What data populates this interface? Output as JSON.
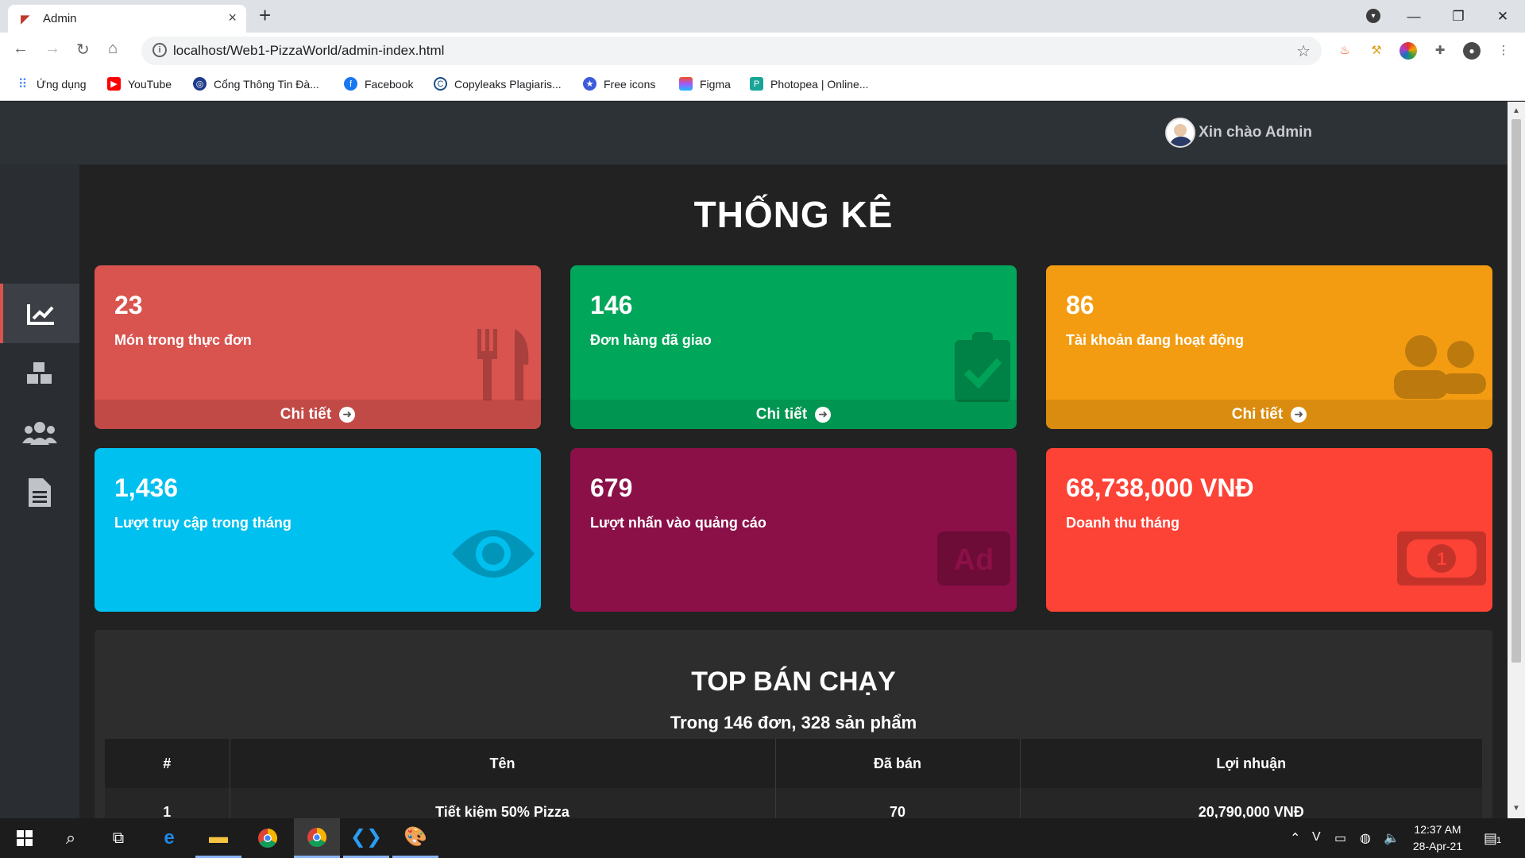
{
  "browser": {
    "tab_title": "Admin",
    "url": "localhost/Web1-PizzaWorld/admin-index.html",
    "bookmarks": [
      {
        "label": "Ứng dụng",
        "icon": "apps-grid-icon",
        "color": "#4285f4"
      },
      {
        "label": "YouTube",
        "icon": "youtube-icon",
        "color": "#ff0000"
      },
      {
        "label": "Cổng Thông Tin Đà...",
        "icon": "portal-icon",
        "color": "#1e3a8a"
      },
      {
        "label": "Facebook",
        "icon": "facebook-icon",
        "color": "#1877f2"
      },
      {
        "label": "Copyleaks Plagiaris...",
        "icon": "copyleaks-icon",
        "color": "#1b4f8a"
      },
      {
        "label": "Free icons",
        "icon": "free-icons-icon",
        "color": "#3b5bdb"
      },
      {
        "label": "Figma",
        "icon": "figma-icon",
        "color": "#f24e1e"
      },
      {
        "label": "Photopea | Online...",
        "icon": "photopea-icon",
        "color": "#18a497"
      }
    ]
  },
  "header": {
    "greeting": "Xin chào Admin"
  },
  "sidebar": {
    "items": [
      {
        "icon": "chart-line-icon",
        "active": true
      },
      {
        "icon": "cubes-icon",
        "active": false
      },
      {
        "icon": "users-icon",
        "active": false
      },
      {
        "icon": "file-alt-icon",
        "active": false
      }
    ]
  },
  "main": {
    "title": "THỐNG KÊ",
    "cards": [
      {
        "value": "23",
        "label": "Món trong thực đơn",
        "footer": "Chi tiết",
        "color": "#d9534f",
        "icon": "utensils-icon"
      },
      {
        "value": "146",
        "label": "Đơn hàng đã giao",
        "footer": "Chi tiết",
        "color": "#00a65a",
        "icon": "clipboard-check-icon"
      },
      {
        "value": "86",
        "label": "Tài khoản đang hoạt động",
        "footer": "Chi tiết",
        "color": "#f39c12",
        "icon": "users-icon"
      },
      {
        "value": "1,436",
        "label": "Lượt truy cập trong tháng",
        "color": "#00c0ef",
        "icon": "eye-icon"
      },
      {
        "value": "679",
        "label": "Lượt nhấn vào quảng cáo",
        "color": "#8b1048",
        "icon": "ad-icon"
      },
      {
        "value": "68,738,000 VNĐ",
        "label": "Doanh thu tháng",
        "color": "#fd4236",
        "icon": "money-bill-icon"
      }
    ],
    "top_selling": {
      "title": "TOP BÁN CHẠY",
      "subtitle": "Trong 146 đơn, 328 sản phẩm",
      "columns": [
        "#",
        "Tên",
        "Đã bán",
        "Lợi nhuận"
      ],
      "rows": [
        {
          "rank": "1",
          "name": "Tiết kiệm 50% Pizza",
          "sold": "70",
          "profit": "20,790,000 VNĐ"
        }
      ]
    }
  },
  "taskbar": {
    "time": "12:37 AM",
    "date": "28-Apr-21",
    "notification_count": "1"
  }
}
